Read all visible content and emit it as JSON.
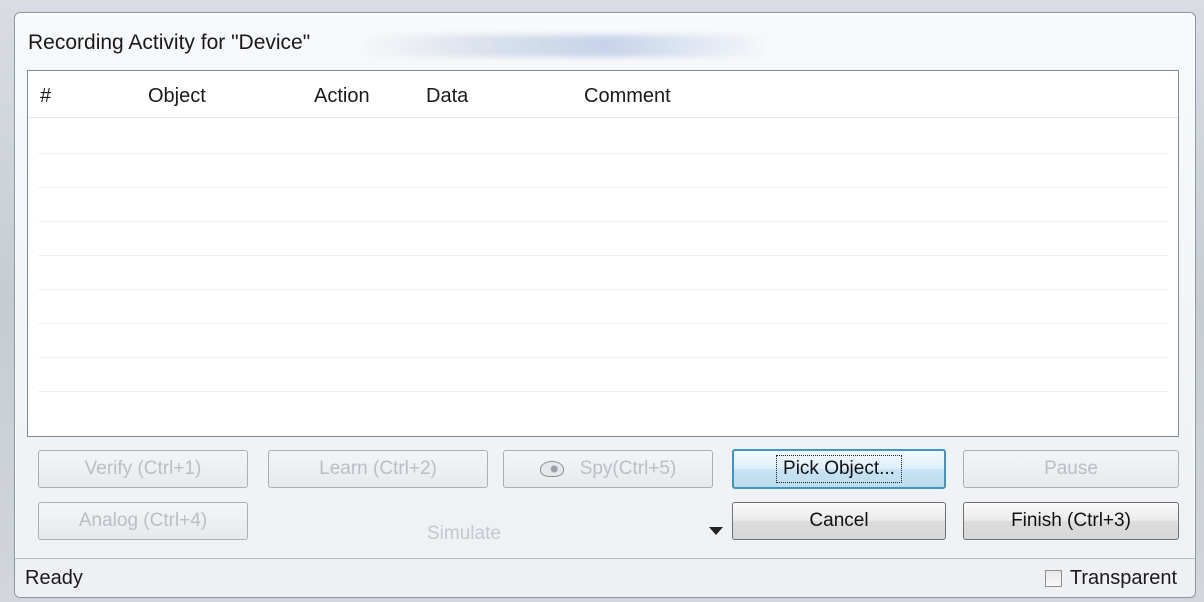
{
  "window": {
    "title": "Recording Activity for \"Device\""
  },
  "list": {
    "columns": [
      "#",
      "Object",
      "Action",
      "Data",
      "Comment"
    ]
  },
  "buttons": {
    "verify": "Verify (Ctrl+1)",
    "learn": "Learn (Ctrl+2)",
    "spy": "Spy(Ctrl+5)",
    "pick_object": "Pick Object...",
    "pause": "Pause",
    "analog": "Analog (Ctrl+4)",
    "cancel": "Cancel",
    "finish": "Finish (Ctrl+3)"
  },
  "simulate_combo": {
    "value": "Simulate"
  },
  "status_bar": {
    "status": "Ready",
    "transparent_label": "Transparent",
    "transparent_checked": false
  },
  "icons": {
    "spy": "spy-eye-icon",
    "dropdown": "chevron-down-icon"
  },
  "colors": {
    "focus_border": "#3c95c6",
    "disabled_text": "#b9bfc6"
  }
}
